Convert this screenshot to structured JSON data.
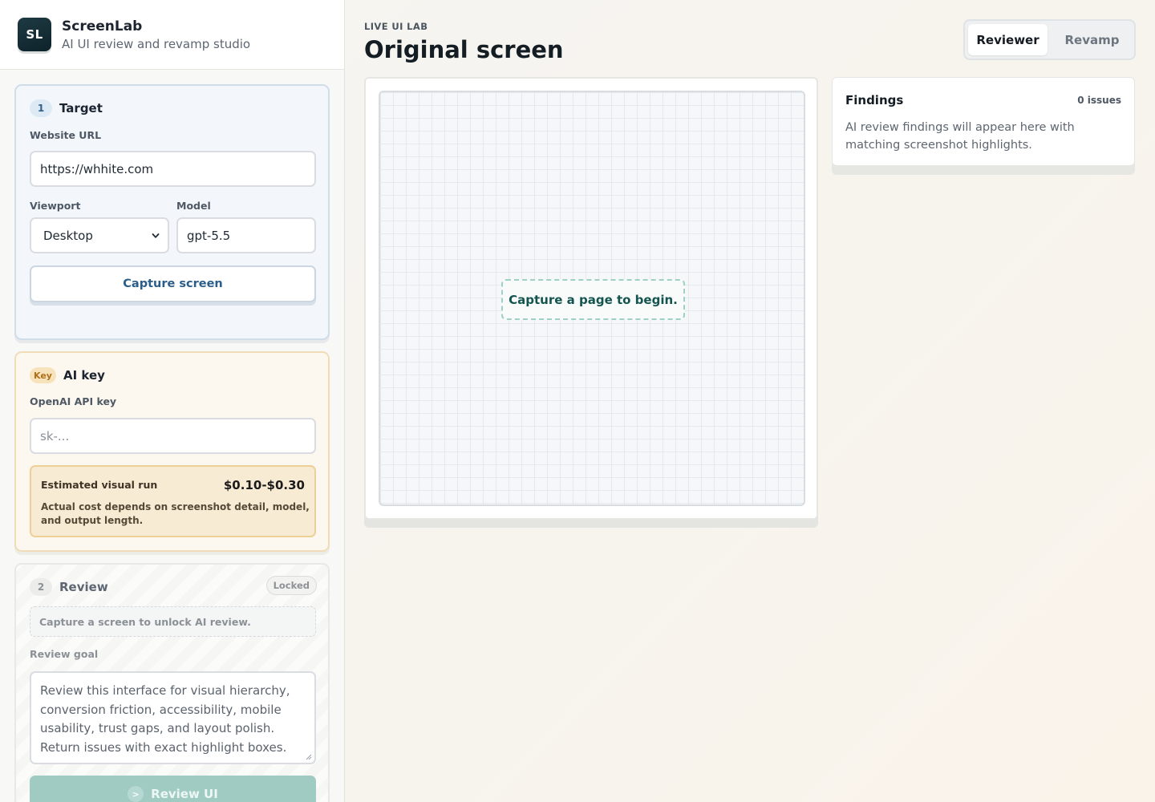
{
  "brand": {
    "logo_text": "SL",
    "name": "ScreenLab",
    "tagline": "AI UI review and revamp studio"
  },
  "target": {
    "step": "1",
    "title": "Target",
    "url_label": "Website URL",
    "url_value": "https://whhite.com",
    "viewport_label": "Viewport",
    "viewport_value": "Desktop",
    "model_label": "Model",
    "model_value": "gpt-5.5",
    "capture_label": "Capture screen"
  },
  "ai_key": {
    "badge": "Key",
    "title": "AI key",
    "api_label": "OpenAI API key",
    "api_placeholder": "sk-...",
    "estimate_label": "Estimated visual run",
    "estimate_value": "$0.10-$0.30",
    "estimate_note": "Actual cost depends on screenshot detail, model, and output length."
  },
  "review": {
    "step": "2",
    "title": "Review",
    "status": "Locked",
    "unlock_note": "Capture a screen to unlock AI review.",
    "goal_label": "Review goal",
    "goal_text": "Review this interface for visual hierarchy, conversion friction, accessibility, mobile usability, trust gaps, and layout polish. Return issues with exact highlight boxes.",
    "button_icon": ">",
    "button_label": "Review UI"
  },
  "main": {
    "eyebrow": "LIVE UI LAB",
    "title": "Original screen",
    "modes": [
      "Reviewer",
      "Revamp"
    ],
    "active_mode": "Reviewer",
    "empty_state": "Capture a page to begin."
  },
  "findings": {
    "title": "Findings",
    "count": "0 issues",
    "note": "AI review findings will appear here with matching screenshot highlights."
  },
  "colors": {
    "accent_blue": "#2a5d8a",
    "accent_teal": "#14544f",
    "amber": "#b06f1a",
    "disabled_teal": "#9fcbc3"
  }
}
